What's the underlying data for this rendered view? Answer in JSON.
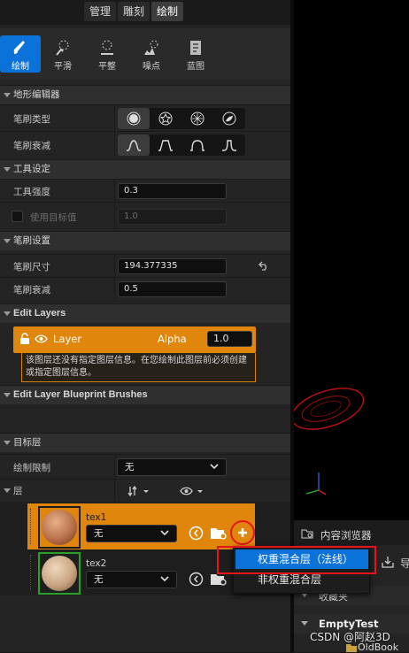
{
  "mode_tabs": [
    "管理",
    "雕刻",
    "绘制"
  ],
  "tools": [
    {
      "icon": "brush-icon",
      "label": "绘制"
    },
    {
      "icon": "smooth-icon",
      "label": "平滑"
    },
    {
      "icon": "flatten-icon",
      "label": "平整"
    },
    {
      "icon": "noise-icon",
      "label": "噪点"
    },
    {
      "icon": "blueprint-icon",
      "label": "蓝图"
    }
  ],
  "sections": {
    "terrain_editor": "地形编辑器",
    "tool_settings": "工具设定",
    "brush_settings": "笔刷设置",
    "edit_layers": "Edit Layers",
    "edit_layer_bp": "Edit Layer Blueprint Brushes",
    "target_layers": "目标层"
  },
  "terrain_editor": {
    "brush_type_label": "笔刷类型",
    "brush_falloff_label": "笔刷衰减"
  },
  "tool_settings": {
    "strength_label": "工具强度",
    "strength_value": "0.3",
    "use_target_label": "使用目标值",
    "use_target_value": "1.0"
  },
  "brush_settings": {
    "size_label": "笔刷尺寸",
    "size_value": "194.377335",
    "falloff_label": "笔刷衰减",
    "falloff_value": "0.5"
  },
  "edit_layers": {
    "layer_name": "Layer",
    "alpha_label": "Alpha",
    "alpha_value": "1.0",
    "warning": "该图层还没有指定图层信息。在您绘制此图层前必须创建或指定图层信息。"
  },
  "target_layers": {
    "paint_restriction_label": "绘制限制",
    "paint_restriction_value": "无",
    "layers_label": "层",
    "items": [
      {
        "name": "tex1",
        "value": "无",
        "selected": true
      },
      {
        "name": "tex2",
        "value": "无",
        "selected": false
      }
    ]
  },
  "context_menu": {
    "items": [
      "权重混合层（法线）",
      "非权重混合层"
    ]
  },
  "content_browser": {
    "title": "内容浏览器",
    "import_label": "导",
    "favorites_label": "收藏夹",
    "project_name": "EmptyTest",
    "folder": "OldBook"
  },
  "watermark": "CSDN @阿赵3D",
  "colors": {
    "accent_blue": "#0a72d8",
    "layer_orange": "#e0860c",
    "highlight_red": "#e8141b"
  }
}
